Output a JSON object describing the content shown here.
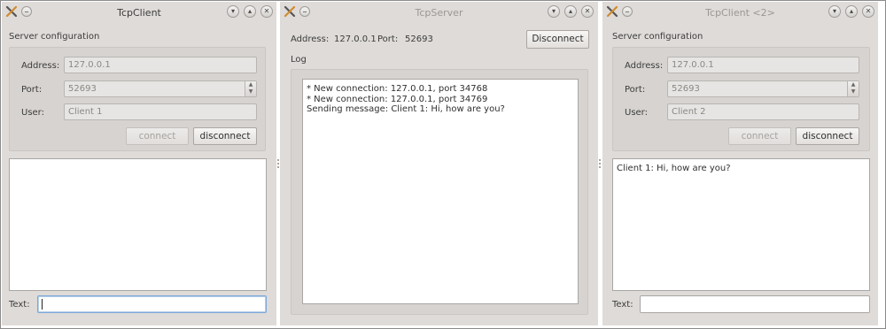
{
  "tcpclient1": {
    "title": "TcpClient",
    "group_title": "Server configuration",
    "address_label": "Address:",
    "address_value": "127.0.0.1",
    "port_label": "Port:",
    "port_value": "52693",
    "user_label": "User:",
    "user_value": "Client 1",
    "connect_label": "connect",
    "disconnect_label": "disconnect",
    "messages": [],
    "text_label": "Text:",
    "text_value": ""
  },
  "tcpserver": {
    "title": "TcpServer",
    "address_label": "Address:",
    "address_value": "127.0.0.1",
    "port_label": "Port:",
    "port_value": "52693",
    "disconnect_label": "Disconnect",
    "log_label": "Log",
    "log_lines": [
      "* New connection: 127.0.0.1, port 34768",
      "* New connection: 127.0.0.1, port 34769",
      "Sending message: Client 1: Hi, how are you?"
    ]
  },
  "tcpclient2": {
    "title": "TcpClient <2>",
    "group_title": "Server configuration",
    "address_label": "Address:",
    "address_value": "127.0.0.1",
    "port_label": "Port:",
    "port_value": "52693",
    "user_label": "User:",
    "user_value": "Client 2",
    "connect_label": "connect",
    "disconnect_label": "disconnect",
    "messages": [
      "Client 1: Hi, how are you?"
    ],
    "text_label": "Text:",
    "text_value": ""
  },
  "icons": {
    "app_icon": "tools-icon",
    "minimize": "minimize-icon",
    "shade": "chevron-down-icon",
    "maximize": "chevron-up-icon",
    "close": "close-icon"
  }
}
